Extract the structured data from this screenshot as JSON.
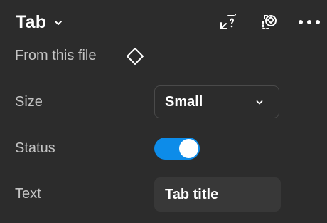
{
  "header": {
    "title": "Tab",
    "title_chevron_icon": "chevron-down-icon",
    "icons": [
      "detach-instance-icon",
      "swap-instance-icon",
      "more-icon"
    ]
  },
  "properties": {
    "source": {
      "label": "From this file",
      "icon": "component-diamond-icon"
    },
    "size": {
      "label": "Size",
      "value": "Small",
      "chevron_icon": "chevron-down-icon"
    },
    "status": {
      "label": "Status",
      "toggle_on": true
    },
    "text": {
      "label": "Text",
      "value": "Tab title"
    }
  },
  "colors": {
    "background": "#2c2c2c",
    "toggle_on": "#0d8ce9",
    "field_background": "#383838",
    "label_text": "#c4c4c4"
  }
}
